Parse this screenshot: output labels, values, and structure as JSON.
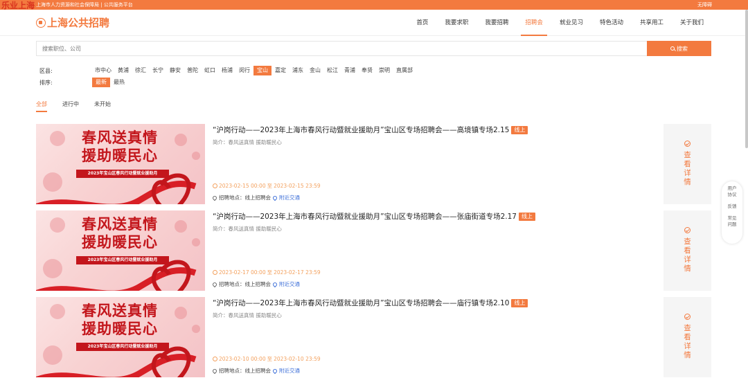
{
  "topbar": {
    "logo_text": "乐业上海",
    "site_text": "上海市人力资源和社会保障局 | 公共服务平台",
    "accessibility": "无障碍"
  },
  "brand": {
    "name": "上海公共招聘"
  },
  "menu": [
    {
      "label": "首页",
      "active": false
    },
    {
      "label": "我要求职",
      "active": false
    },
    {
      "label": "我要招聘",
      "active": false
    },
    {
      "label": "招聘会",
      "active": true
    },
    {
      "label": "就业见习",
      "active": false
    },
    {
      "label": "特色活动",
      "active": false
    },
    {
      "label": "共享用工",
      "active": false
    },
    {
      "label": "关于我们",
      "active": false
    }
  ],
  "search": {
    "placeholder": "搜索职位、公司",
    "button": "搜索"
  },
  "filters": {
    "district_label": "区县:",
    "districts": [
      "市中心",
      "黄浦",
      "徐汇",
      "长宁",
      "静安",
      "普陀",
      "虹口",
      "杨浦",
      "闵行",
      "宝山",
      "嘉定",
      "浦东",
      "金山",
      "松江",
      "青浦",
      "奉贤",
      "崇明",
      "直属部"
    ],
    "district_selected": "宝山",
    "sort_label": "排序:",
    "sorts": [
      "最新",
      "最热"
    ],
    "sort_selected": "最新"
  },
  "tabs": [
    {
      "label": "全部",
      "active": true
    },
    {
      "label": "进行中",
      "active": false
    },
    {
      "label": "未开始",
      "active": false
    }
  ],
  "banner": {
    "line1": "春风送真情",
    "line2": "援助暖民心",
    "strip": "2023年宝山区春风行动暨就业援助月"
  },
  "fairs": [
    {
      "title": "“沪岗行动——2023年上海市春风行动暨就业援助月”宝山区专场招聘会——高境镇专场2.15",
      "badge": "线上",
      "intro": "简介：春风送真情 援助暖民心",
      "start": "2023-02-15 00:00",
      "end": "2023-02-15 23:59",
      "place": "招聘地点：线上招聘会",
      "nearby": "附近交通",
      "detail": "查看详情"
    },
    {
      "title": "“沪岗行动——2023年上海市春风行动暨就业援助月”宝山区专场招聘会——张庙街道专场2.17",
      "badge": "线上",
      "intro": "简介：春风送真情 援助暖民心",
      "start": "2023-02-17 00:00",
      "end": "2023-02-17 23:59",
      "place": "招聘地点：线上招聘会",
      "nearby": "附近交通",
      "detail": "查看详情"
    },
    {
      "title": "“沪岗行动——2023年上海市春风行动暨就业援助月”宝山区专场招聘会——庙行镇专场2.10",
      "badge": "线上",
      "intro": "简介：春风送真情 援助暖民心",
      "start": "2023-02-10 00:00",
      "end": "2023-02-10 23:59",
      "place": "招聘地点：线上招聘会",
      "nearby": "附近交通",
      "detail": "查看详情"
    }
  ],
  "date_sep": "至",
  "sidebar": [
    "用户协议",
    "反馈",
    "常见问题"
  ],
  "colors": {
    "accent": "#f37a3f",
    "banner_red": "#c3161c",
    "link": "#3d6fd8"
  }
}
